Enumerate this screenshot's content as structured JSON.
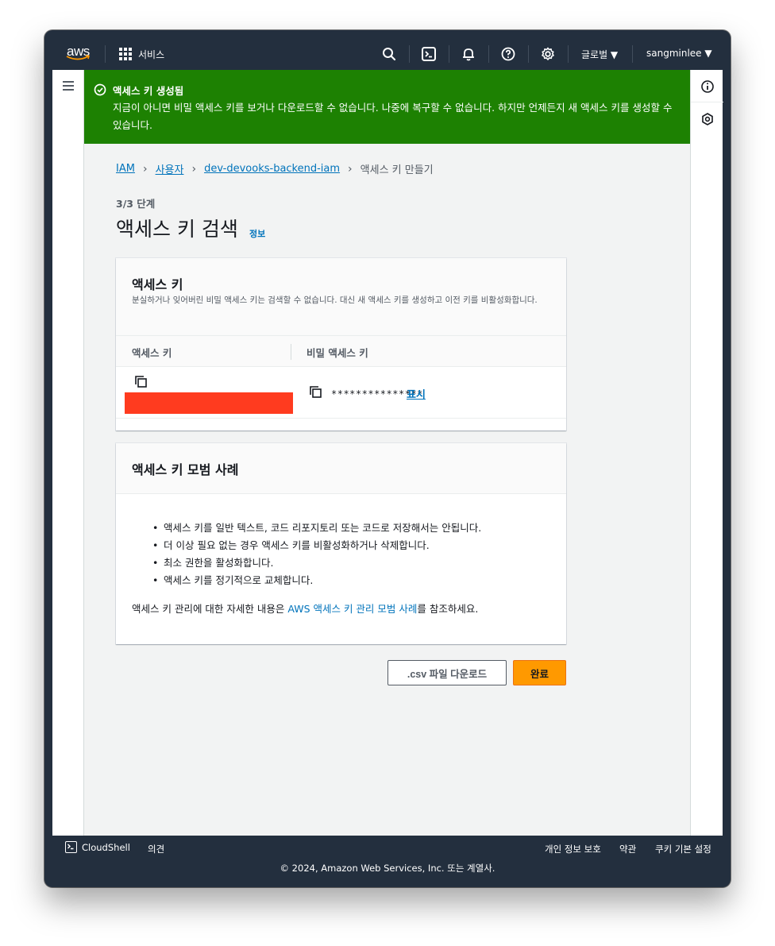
{
  "nav": {
    "logo_text": "aws",
    "services": "서비스",
    "region": "글로벌 ▼",
    "user": "sangminlee ▼"
  },
  "flash": {
    "title": "액세스 키 생성됨",
    "message": "지금이 아니면 비밀 액세스 키를 보거나 다운로드할 수 없습니다. 나중에 복구할 수 없습니다. 하지만 언제든지 새 액세스 키를 생성할 수 있습니다."
  },
  "breadcrumb": [
    "IAM",
    "사용자",
    "dev-devooks-backend-iam",
    "액세스 키 만들기"
  ],
  "step": "3/3 단계",
  "page_title": "액세스 키 검색",
  "info": "정보",
  "access_key_card": {
    "title": "액세스 키",
    "description": "분실하거나 잊어버린 비밀 액세스 키는 검색할 수 없습니다. 대신 새 액세스 키를 생성하고 이전 키를 비활성화합니다.",
    "col_access_key": "액세스 키",
    "col_secret_key": "비밀 액세스 키",
    "secret_masked": "***************",
    "show": "표시"
  },
  "best_practice_card": {
    "title": "액세스 키 모범 사례",
    "items": [
      "액세스 키를 일반 텍스트, 코드 리포지토리 또는 코드로 저장해서는 안됩니다.",
      "더 이상 필요 없는 경우 액세스 키를 비활성화하거나 삭제합니다.",
      "최소 권한을 활성화합니다.",
      "액세스 키를 정기적으로 교체합니다."
    ],
    "foot_before": "액세스 키 관리에 대한 자세한 내용은 ",
    "foot_link": "AWS 액세스 키 관리 모범 사례",
    "foot_after": "를 참조하세요."
  },
  "buttons": {
    "download_csv": ".csv 파일 다운로드",
    "done": "완료"
  },
  "footer": {
    "cloudshell": "CloudShell",
    "feedback": "의견",
    "privacy": "개인 정보 보호",
    "terms": "약관",
    "cookies": "쿠키 기본 설정",
    "copyright": "© 2024, Amazon Web Services, Inc. 또는 계열사."
  },
  "colors": {
    "nav_bg": "#232f3e",
    "success": "#1d8102",
    "link": "#0073bb",
    "primary_button": "#ff9900",
    "redacted": "#ff3b1f"
  }
}
